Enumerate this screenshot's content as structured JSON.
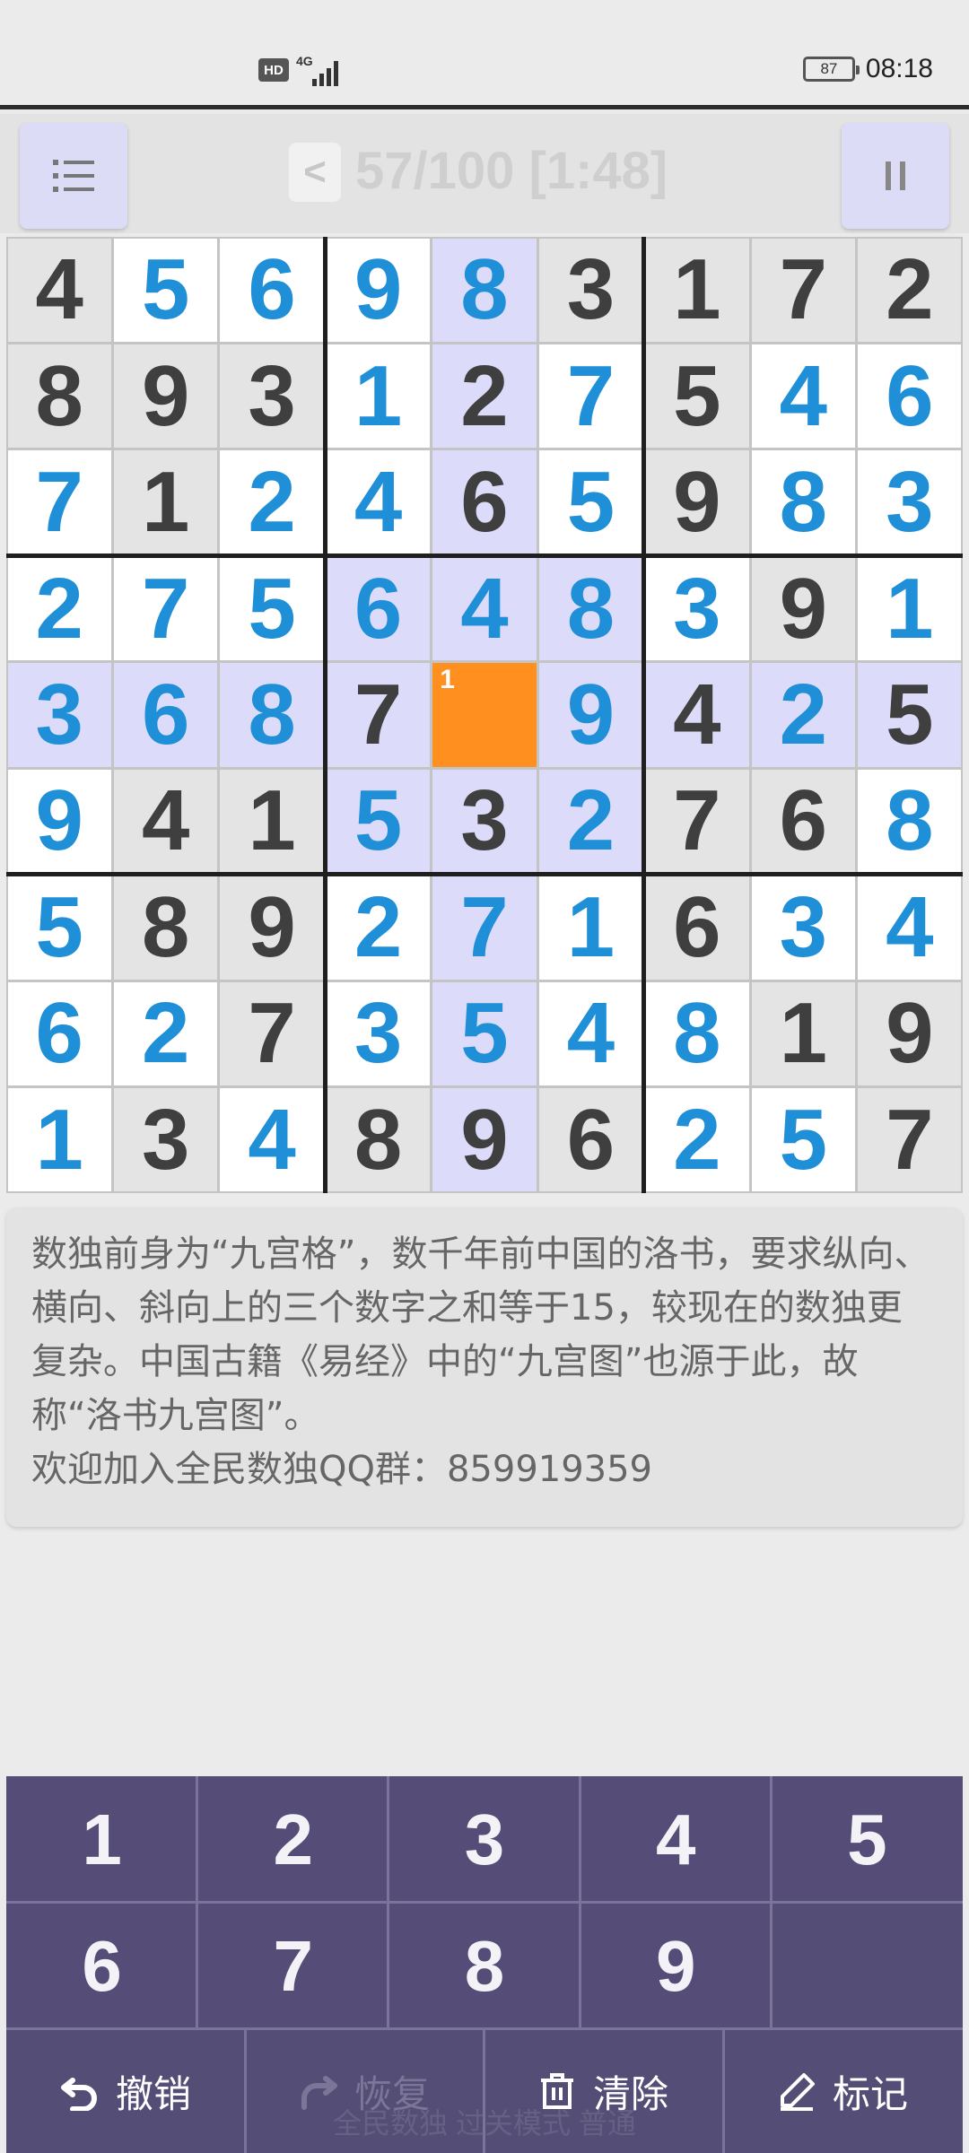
{
  "status_bar": {
    "hd": "HD",
    "network": "4G",
    "battery": "87",
    "time": "08:18"
  },
  "header": {
    "back_label": "<",
    "level_text": "57/100 [1:48]"
  },
  "board": {
    "rows": [
      [
        "4",
        "5",
        "6",
        "9",
        "8",
        "3",
        "1",
        "7",
        "2"
      ],
      [
        "8",
        "9",
        "3",
        "1",
        "2",
        "7",
        "5",
        "4",
        "6"
      ],
      [
        "7",
        "1",
        "2",
        "4",
        "6",
        "5",
        "9",
        "8",
        "3"
      ],
      [
        "2",
        "7",
        "5",
        "6",
        "4",
        "8",
        "3",
        "9",
        "1"
      ],
      [
        "3",
        "6",
        "8",
        "7",
        "",
        "9",
        "4",
        "2",
        "5"
      ],
      [
        "9",
        "4",
        "1",
        "5",
        "3",
        "2",
        "7",
        "6",
        "8"
      ],
      [
        "5",
        "8",
        "9",
        "2",
        "7",
        "1",
        "6",
        "3",
        "4"
      ],
      [
        "6",
        "2",
        "7",
        "3",
        "5",
        "4",
        "8",
        "1",
        "9"
      ],
      [
        "1",
        "3",
        "4",
        "8",
        "9",
        "6",
        "2",
        "5",
        "7"
      ]
    ],
    "given": [
      [
        1,
        0,
        0,
        0,
        0,
        1,
        1,
        1,
        1
      ],
      [
        1,
        1,
        1,
        0,
        1,
        0,
        1,
        0,
        0
      ],
      [
        0,
        1,
        0,
        0,
        1,
        0,
        1,
        0,
        0
      ],
      [
        0,
        0,
        0,
        0,
        0,
        0,
        0,
        1,
        0
      ],
      [
        0,
        0,
        0,
        1,
        0,
        0,
        1,
        0,
        1
      ],
      [
        0,
        1,
        1,
        0,
        1,
        0,
        1,
        1,
        0
      ],
      [
        0,
        1,
        1,
        0,
        0,
        0,
        1,
        0,
        0
      ],
      [
        0,
        0,
        1,
        0,
        0,
        0,
        0,
        1,
        1
      ],
      [
        0,
        1,
        0,
        1,
        1,
        1,
        0,
        0,
        1
      ]
    ],
    "selected_row": 4,
    "selected_col": 4,
    "selected_note": "1",
    "colors": {
      "given_bg": "#e4e4e4",
      "given_text": "#3f3f3f",
      "filled_bg": "#ffffff",
      "filled_text": "#1f8fd8",
      "highlight_bg": "#dcdcfa",
      "selected_bg": "#ff9020"
    }
  },
  "info": {
    "text": "数独前身为“九宫格”，数千年前中国的洛书，要求纵向、横向、斜向上的三个数字之和等于15，较现在的数独更复杂。中国古籍《易经》中的“九宫图”也源于此，故称“洛书九宫图”。\n欢迎加入全民数独QQ群：859919359"
  },
  "keypad": {
    "digits": [
      "1",
      "2",
      "3",
      "4",
      "5",
      "6",
      "7",
      "8",
      "9"
    ],
    "undo": "撤销",
    "redo": "恢复",
    "clear": "清除",
    "mark": "标记",
    "footer": "全民数独 过关模式 普通"
  }
}
